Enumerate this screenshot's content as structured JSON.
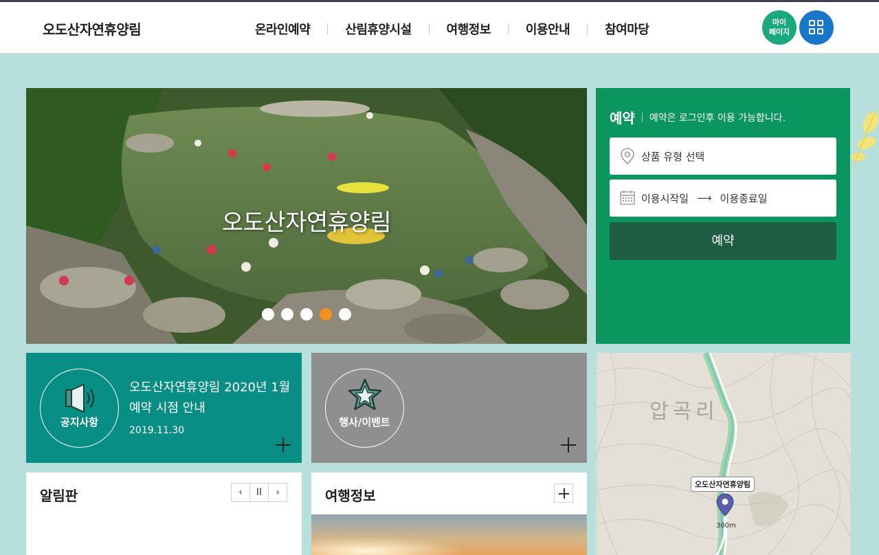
{
  "header": {
    "logo": "오도산자연휴양림",
    "nav": [
      "온라인예약",
      "산림휴양시설",
      "여행정보",
      "이용안내",
      "참여마당"
    ],
    "mypage_label_line1": "마이",
    "mypage_label_line2": "페이지",
    "menu_icon": "grid-icon"
  },
  "hero": {
    "title": "오도산자연휴양림",
    "slides_total": 5,
    "active_slide": 4
  },
  "reservation": {
    "title": "예약",
    "note": "예약은 로그인후 이용 가능합니다.",
    "product_placeholder": "상품 유형 선택",
    "start_label": "이용시작일",
    "arrow": "⟶",
    "end_label": "이용종료일",
    "submit_label": "예약"
  },
  "notice": {
    "label": "공지사항",
    "title": "오도산자연휴양림 2020년 1월 예약 시점 안내",
    "date": "2019.11.30"
  },
  "event": {
    "label": "행사/이벤트"
  },
  "map": {
    "area_label": "압곡리",
    "pin_label": "오도산자연휴양림",
    "scale": "300m"
  },
  "board": {
    "title": "알림판",
    "prev": "‹",
    "pause": "II",
    "next": "›"
  },
  "travel": {
    "title": "여행정보"
  },
  "colors": {
    "page_bg": "#b7e0dc",
    "reserve_bg": "#0b9660",
    "reserve_button": "#1f5e44",
    "notice_bg": "#088e85",
    "event_bg": "#8f8f8f",
    "mypage_btn": "#1aa97c",
    "menu_btn": "#1876c9",
    "active_dot": "#f28f1d"
  }
}
